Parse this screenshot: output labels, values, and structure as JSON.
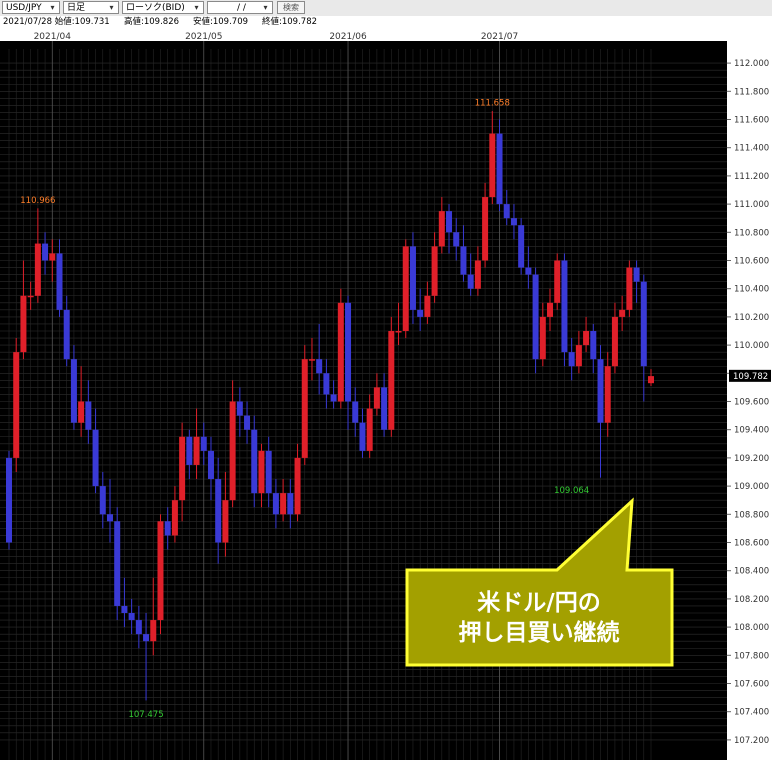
{
  "toolbar": {
    "pair": "USD/JPY",
    "timeframe": "日足",
    "chart_type": "ローソク(BID)",
    "date_input": "/ /",
    "search_label": "検索"
  },
  "info": {
    "date_open": "2021/07/28 始値:109.731",
    "high": "高値:109.826",
    "low": "安値:109.709",
    "close": "終値:109.782"
  },
  "annotation": {
    "line1": "米ドル/円の",
    "line2": "押し目買い継続"
  },
  "colors": {
    "background": "#000000",
    "bull": "#e0202a",
    "bear": "#3a3ad6",
    "grid": "#3a3a3a",
    "callout_fill": "#a3a000",
    "callout_border": "#ffff33",
    "high_label": "#ff7f2a",
    "low_label": "#33cc33"
  },
  "chart_data": {
    "type": "candlestick",
    "y_range": [
      107.1,
      112.1
    ],
    "y_ticks": [
      "112.000",
      "111.800",
      "111.600",
      "111.400",
      "111.200",
      "111.000",
      "110.800",
      "110.600",
      "110.400",
      "110.200",
      "110.000",
      "109.800",
      "109.600",
      "109.400",
      "109.200",
      "109.000",
      "108.800",
      "108.600",
      "108.400",
      "108.200",
      "108.000",
      "107.800",
      "107.600",
      "107.400",
      "107.200"
    ],
    "x_labels": [
      {
        "label": "2021/04",
        "index": 6
      },
      {
        "label": "2021/05",
        "index": 27
      },
      {
        "label": "2021/06",
        "index": 47
      },
      {
        "label": "2021/07",
        "index": 68
      }
    ],
    "current_price": "109.782",
    "high_marker": {
      "label": "110.966",
      "index": 4
    },
    "high_marker2": {
      "label": "111.658",
      "index": 67
    },
    "low_marker": {
      "label": "107.475",
      "index": 19
    },
    "low_marker2": {
      "label": "109.064",
      "index": 78
    },
    "candles": [
      [
        109.2,
        108.6,
        109.25,
        108.55
      ],
      [
        109.2,
        109.95,
        110.05,
        109.1
      ],
      [
        109.95,
        110.35,
        110.6,
        109.9
      ],
      [
        110.35,
        110.35,
        110.45,
        110.25
      ],
      [
        110.35,
        110.72,
        110.97,
        110.3
      ],
      [
        110.72,
        110.6,
        110.8,
        110.5
      ],
      [
        110.6,
        110.65,
        110.75,
        110.45
      ],
      [
        110.65,
        110.25,
        110.75,
        110.2
      ],
      [
        110.25,
        109.9,
        110.35,
        109.85
      ],
      [
        109.9,
        109.45,
        110.0,
        109.4
      ],
      [
        109.45,
        109.6,
        109.85,
        109.35
      ],
      [
        109.6,
        109.4,
        109.75,
        109.3
      ],
      [
        109.4,
        109.0,
        109.55,
        108.95
      ],
      [
        109.0,
        108.8,
        109.1,
        108.7
      ],
      [
        108.8,
        108.75,
        109.05,
        108.6
      ],
      [
        108.75,
        108.15,
        108.85,
        108.05
      ],
      [
        108.15,
        108.1,
        108.35,
        108.0
      ],
      [
        108.1,
        108.05,
        108.2,
        107.95
      ],
      [
        108.05,
        107.95,
        108.15,
        107.85
      ],
      [
        107.95,
        107.9,
        108.1,
        107.48
      ],
      [
        107.9,
        108.05,
        108.35,
        107.8
      ],
      [
        108.05,
        108.75,
        108.8,
        107.95
      ],
      [
        108.75,
        108.65,
        108.85,
        108.55
      ],
      [
        108.65,
        108.9,
        109.0,
        108.6
      ],
      [
        108.9,
        109.35,
        109.45,
        108.75
      ],
      [
        109.35,
        109.15,
        109.4,
        109.05
      ],
      [
        109.15,
        109.35,
        109.55,
        109.05
      ],
      [
        109.35,
        109.25,
        109.45,
        109.15
      ],
      [
        109.25,
        109.05,
        109.35,
        108.9
      ],
      [
        109.05,
        108.6,
        109.2,
        108.45
      ],
      [
        108.6,
        108.9,
        109.1,
        108.5
      ],
      [
        108.9,
        109.6,
        109.75,
        108.85
      ],
      [
        109.6,
        109.5,
        109.7,
        109.35
      ],
      [
        109.5,
        109.4,
        109.6,
        109.3
      ],
      [
        109.4,
        108.95,
        109.5,
        108.85
      ],
      [
        108.95,
        109.25,
        109.3,
        108.85
      ],
      [
        109.25,
        108.95,
        109.35,
        108.85
      ],
      [
        108.95,
        108.8,
        109.05,
        108.7
      ],
      [
        108.8,
        108.95,
        109.05,
        108.75
      ],
      [
        108.95,
        108.8,
        109.05,
        108.7
      ],
      [
        108.8,
        109.2,
        109.3,
        108.75
      ],
      [
        109.2,
        109.9,
        110.0,
        109.15
      ],
      [
        109.9,
        109.9,
        110.05,
        109.75
      ],
      [
        109.9,
        109.8,
        110.15,
        109.65
      ],
      [
        109.8,
        109.65,
        109.9,
        109.55
      ],
      [
        109.65,
        109.6,
        109.75,
        109.55
      ],
      [
        109.6,
        110.3,
        110.4,
        109.55
      ],
      [
        110.3,
        109.6,
        110.35,
        109.4
      ],
      [
        109.6,
        109.45,
        109.7,
        109.35
      ],
      [
        109.45,
        109.25,
        109.55,
        109.2
      ],
      [
        109.25,
        109.55,
        109.65,
        109.2
      ],
      [
        109.55,
        109.7,
        109.8,
        109.5
      ],
      [
        109.7,
        109.4,
        109.8,
        109.35
      ],
      [
        109.4,
        110.1,
        110.2,
        109.35
      ],
      [
        110.1,
        110.1,
        110.3,
        110.0
      ],
      [
        110.1,
        110.7,
        110.75,
        110.05
      ],
      [
        110.7,
        110.25,
        110.8,
        110.15
      ],
      [
        110.25,
        110.2,
        110.4,
        110.1
      ],
      [
        110.2,
        110.35,
        110.45,
        110.15
      ],
      [
        110.35,
        110.7,
        110.8,
        110.3
      ],
      [
        110.7,
        110.95,
        111.05,
        110.65
      ],
      [
        110.95,
        110.8,
        111.0,
        110.65
      ],
      [
        110.8,
        110.7,
        110.9,
        110.6
      ],
      [
        110.7,
        110.5,
        110.85,
        110.45
      ],
      [
        110.5,
        110.4,
        110.65,
        110.35
      ],
      [
        110.4,
        110.6,
        110.7,
        110.35
      ],
      [
        110.6,
        111.05,
        111.15,
        110.55
      ],
      [
        111.05,
        111.5,
        111.66,
        111.0
      ],
      [
        111.5,
        111.0,
        111.6,
        110.95
      ],
      [
        111.0,
        110.9,
        111.1,
        110.85
      ],
      [
        110.9,
        110.85,
        111.0,
        110.75
      ],
      [
        110.85,
        110.55,
        110.9,
        110.5
      ],
      [
        110.55,
        110.5,
        110.7,
        110.4
      ],
      [
        110.5,
        109.9,
        110.55,
        109.8
      ],
      [
        109.9,
        110.2,
        110.3,
        109.85
      ],
      [
        110.2,
        110.3,
        110.4,
        110.1
      ],
      [
        110.3,
        110.6,
        110.65,
        110.25
      ],
      [
        110.6,
        109.95,
        110.65,
        109.85
      ],
      [
        109.95,
        109.85,
        110.05,
        109.75
      ],
      [
        109.85,
        110.0,
        110.1,
        109.8
      ],
      [
        110.0,
        110.1,
        110.2,
        109.95
      ],
      [
        110.1,
        109.9,
        110.15,
        109.8
      ],
      [
        109.9,
        109.45,
        110.0,
        109.06
      ],
      [
        109.45,
        109.85,
        109.95,
        109.35
      ],
      [
        109.85,
        110.2,
        110.3,
        109.8
      ],
      [
        110.2,
        110.25,
        110.35,
        110.1
      ],
      [
        110.25,
        110.55,
        110.6,
        110.2
      ],
      [
        110.55,
        110.45,
        110.6,
        110.3
      ],
      [
        110.45,
        109.85,
        110.5,
        109.6
      ],
      [
        109.73,
        109.78,
        109.83,
        109.71
      ]
    ]
  }
}
